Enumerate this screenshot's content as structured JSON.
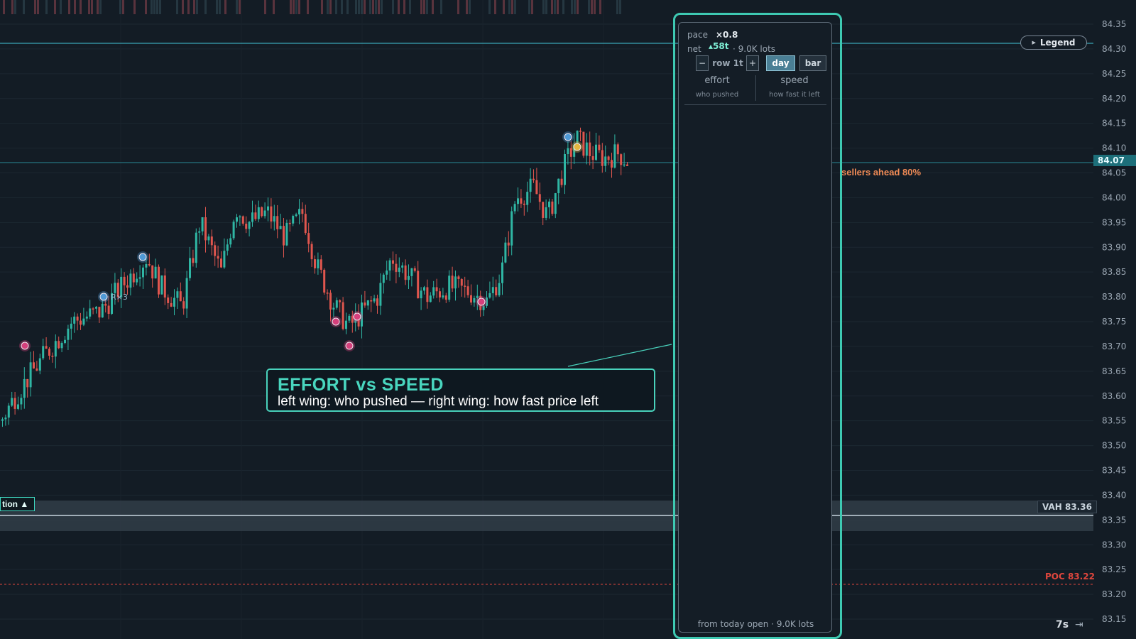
{
  "price_axis": {
    "ticks": [
      "84.35",
      "84.30",
      "84.25",
      "84.20",
      "84.15",
      "84.10",
      "84.05",
      "84.00",
      "83.95",
      "83.90",
      "83.85",
      "83.80",
      "83.75",
      "83.70",
      "83.65",
      "83.60",
      "83.55",
      "83.50",
      "83.45",
      "83.40",
      "83.35",
      "83.30",
      "83.25",
      "83.20",
      "83.15"
    ],
    "last_price": "84.07",
    "vah_label": "VAH 83.36",
    "poc_label": "POC 83.22"
  },
  "levels": {
    "value_area_low": 83.33,
    "value_area_high": 83.39,
    "upper_line": 84.3
  },
  "candles": {
    "description_color_up": "#2fb6a4",
    "color_down": "#e0564e"
  },
  "markers": [
    {
      "type": "pink",
      "x_index": 0
    },
    {
      "type": "blue",
      "label": "R×3"
    },
    {
      "type": "blue"
    },
    {
      "type": "pink"
    },
    {
      "type": "pink"
    },
    {
      "type": "pink"
    },
    {
      "type": "pink"
    },
    {
      "type": "blue"
    },
    {
      "type": "yellow"
    }
  ],
  "marker_label": "R×3",
  "legend_button": "Legend",
  "session_tag": "tion ▲",
  "sellers_note": "sellers ahead 80%",
  "callout": {
    "title": "EFFORT vs SPEED",
    "subtitle": "left wing: who pushed — right wing: how fast price left"
  },
  "panel": {
    "pace_label": "pace",
    "pace_value": "×0.8",
    "net_label": "net",
    "net_value": "▴58t",
    "net_lots": "· 9.0K lots",
    "minus": "−",
    "row_label": "row 1t",
    "plus": "+",
    "day_button": "day",
    "bar_button": "bar",
    "effort_header": "effort",
    "effort_sub": "who pushed",
    "speed_header": "speed",
    "speed_sub": "how fast it left",
    "footer": "from today open · 9.0K lots"
  },
  "timer": "7s",
  "colors": {
    "background": "#131c25",
    "accent_teal": "#3ec9b2",
    "up_candle": "#2fb6a4",
    "down_candle": "#e0564e",
    "marker_pink": "#d6407c",
    "marker_blue": "#4f9ad6",
    "marker_yellow": "#e4b640",
    "poc": "#e0463d",
    "sellers_note": "#f08a55"
  },
  "icons": {
    "legend": "caret-right-icon",
    "timer": "arrow-to-edge-icon"
  }
}
